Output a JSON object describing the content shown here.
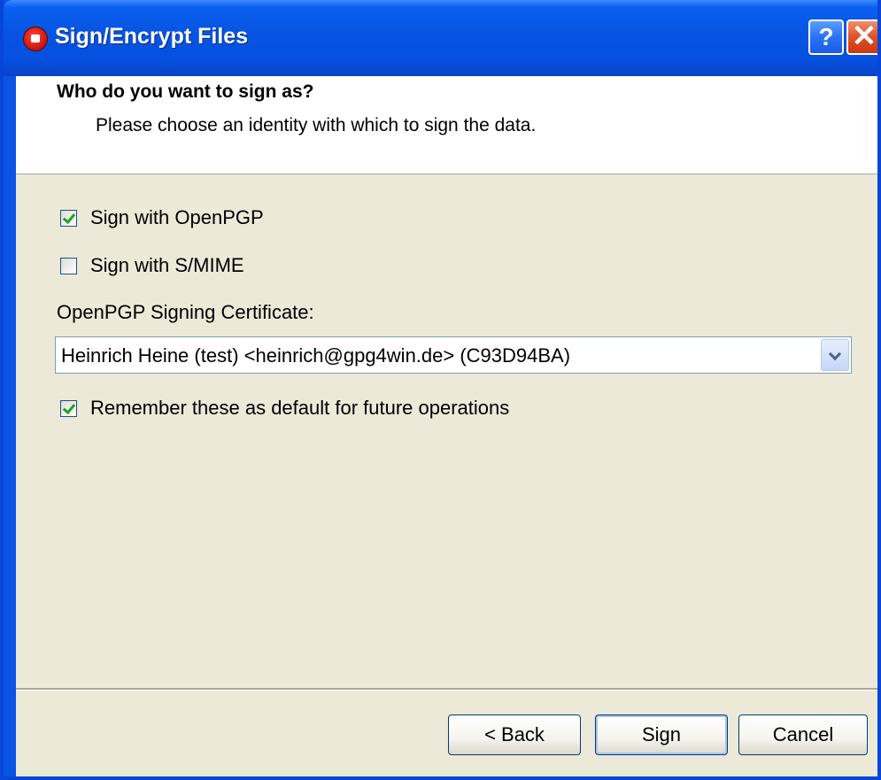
{
  "window": {
    "title": "Sign/Encrypt Files",
    "help_label": "?",
    "close_label": "✕"
  },
  "header": {
    "title": "Who do you want to sign as?",
    "subtitle": "Please choose an identity with which to sign the data."
  },
  "options": {
    "sign_openpgp": {
      "label": "Sign with OpenPGP",
      "checked": true
    },
    "sign_smime": {
      "label": "Sign with S/MIME",
      "checked": false
    },
    "certificate_label": "OpenPGP Signing Certificate:",
    "certificate_value": "Heinrich Heine (test) <heinrich@gpg4win.de> (C93D94BA)",
    "remember": {
      "label": "Remember these as default for future operations",
      "checked": true
    }
  },
  "buttons": {
    "back": "< Back",
    "sign": "Sign",
    "cancel": "Cancel"
  },
  "colors": {
    "titlebar": "#0755e3",
    "dialog_face": "#ece9d8",
    "close_button": "#e0502a",
    "checkmark": "#21a121"
  }
}
